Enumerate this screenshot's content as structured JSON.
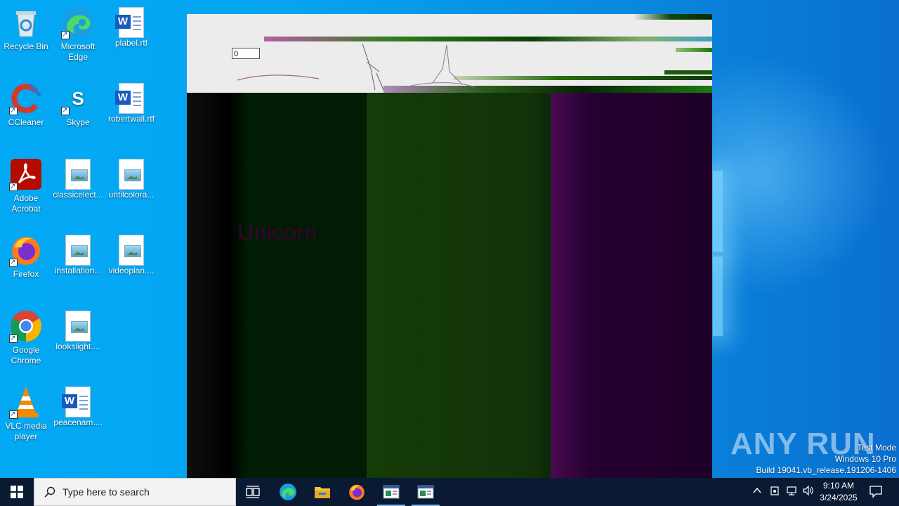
{
  "desktop": {
    "icons": [
      {
        "label": "Recycle Bin",
        "icon": "recycle-bin-icon"
      },
      {
        "label": "Microsoft Edge",
        "icon": "edge-icon"
      },
      {
        "label": "plabel.rtf",
        "icon": "word-document-icon"
      },
      {
        "label": "CCleaner",
        "icon": "ccleaner-icon"
      },
      {
        "label": "Skype",
        "icon": "skype-icon"
      },
      {
        "label": "robertwall.rtf",
        "icon": "word-document-icon"
      },
      {
        "label": "Adobe Acrobat",
        "icon": "acrobat-icon"
      },
      {
        "label": "classicelect...",
        "icon": "image-file-icon"
      },
      {
        "label": "untilcolora...",
        "icon": "image-file-icon"
      },
      {
        "label": "Firefox",
        "icon": "firefox-icon"
      },
      {
        "label": "installation...",
        "icon": "image-file-icon"
      },
      {
        "label": "videoplan....",
        "icon": "image-file-icon"
      },
      {
        "label": "Google Chrome",
        "icon": "chrome-icon"
      },
      {
        "label": "lookslight....",
        "icon": "image-file-icon"
      },
      {
        "label": "VLC media player",
        "icon": "vlc-icon"
      },
      {
        "label": "peacenam....",
        "icon": "word-document-icon"
      }
    ]
  },
  "app": {
    "field_value": "0",
    "body_text": "Unicorn"
  },
  "watermark": {
    "brand": "ANY RUN",
    "line1": "Test Mode",
    "line2": "Windows 10 Pro",
    "line3": "Build 19041.vb_release.191206-1406"
  },
  "taskbar": {
    "search_placeholder": "Type here to search",
    "pinned": [
      "task-view-icon",
      "edge-icon",
      "file-explorer-icon",
      "firefox-icon",
      "app-window-icon",
      "app-window-icon"
    ],
    "time": "9:10 AM",
    "date": "3/24/2025"
  },
  "colors": {
    "taskbar": "#0b1a33",
    "desktop_blue": "#03a9f4",
    "unicorn_text": "#3b0030"
  }
}
